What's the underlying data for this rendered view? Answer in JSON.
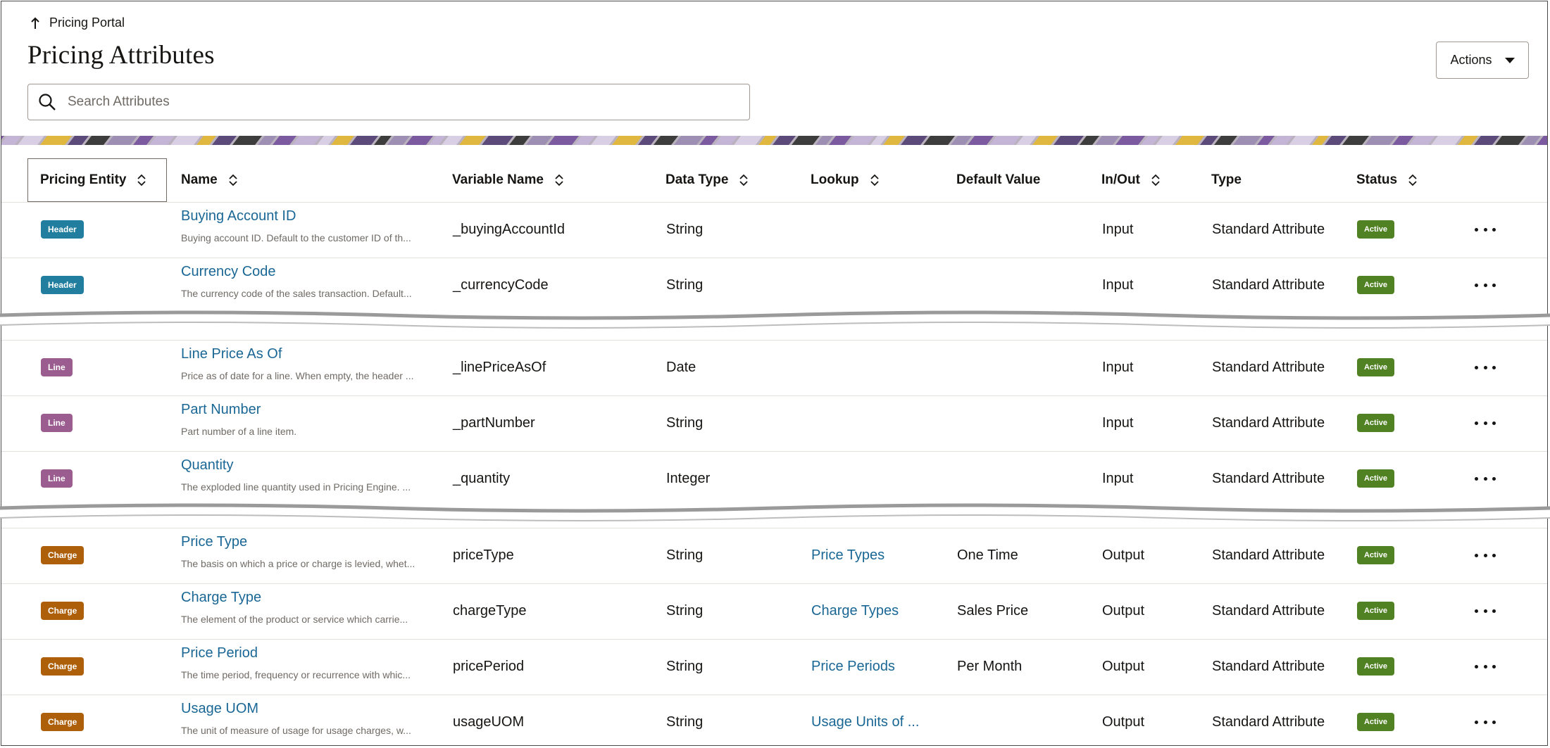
{
  "breadcrumb": {
    "label": "Pricing Portal"
  },
  "page": {
    "title": "Pricing Attributes"
  },
  "search": {
    "placeholder": "Search Attributes",
    "value": ""
  },
  "actions": {
    "label": "Actions"
  },
  "columns": [
    "Pricing Entity",
    "Name",
    "Variable Name",
    "Data Type",
    "Lookup",
    "Default Value",
    "In/Out",
    "Type",
    "Status"
  ],
  "rows": [
    {
      "entity": "Header",
      "entity_color": "#227e9e",
      "name": "Buying Account ID",
      "description": "Buying account ID. Default to the customer ID of th...",
      "variable": "_buyingAccountId",
      "data_type": "String",
      "lookup": "",
      "default_value": "",
      "in_out": "Input",
      "type": "Standard Attribute",
      "status": "Active"
    },
    {
      "entity": "Header",
      "entity_color": "#227e9e",
      "name": "Currency Code",
      "description": "The currency code of the sales transaction. Default...",
      "variable": "_currencyCode",
      "data_type": "String",
      "lookup": "",
      "default_value": "",
      "in_out": "Input",
      "type": "Standard Attribute",
      "status": "Active"
    },
    {
      "entity": "Line",
      "entity_color": "#9b5c8f",
      "name": "Line Price As Of",
      "description": "Price as of date for a line. When empty, the header ...",
      "variable": "_linePriceAsOf",
      "data_type": "Date",
      "lookup": "",
      "default_value": "",
      "in_out": "Input",
      "type": "Standard Attribute",
      "status": "Active"
    },
    {
      "entity": "Line",
      "entity_color": "#9b5c8f",
      "name": "Part Number",
      "description": "Part number of a line item.",
      "variable": "_partNumber",
      "data_type": "String",
      "lookup": "",
      "default_value": "",
      "in_out": "Input",
      "type": "Standard Attribute",
      "status": "Active"
    },
    {
      "entity": "Line",
      "entity_color": "#9b5c8f",
      "name": "Quantity",
      "description": "The exploded line quantity used in Pricing Engine. ...",
      "variable": "_quantity",
      "data_type": "Integer",
      "lookup": "",
      "default_value": "",
      "in_out": "Input",
      "type": "Standard Attribute",
      "status": "Active"
    },
    {
      "entity": "Charge",
      "entity_color": "#ad5f0a",
      "name": "Price Type",
      "description": "The basis on which a price or charge is levied, whet...",
      "variable": "priceType",
      "data_type": "String",
      "lookup": "Price Types",
      "default_value": "One Time",
      "in_out": "Output",
      "type": "Standard Attribute",
      "status": "Active"
    },
    {
      "entity": "Charge",
      "entity_color": "#ad5f0a",
      "name": "Charge Type",
      "description": "The element of the product or service which carrie...",
      "variable": "chargeType",
      "data_type": "String",
      "lookup": "Charge Types",
      "default_value": "Sales Price",
      "in_out": "Output",
      "type": "Standard Attribute",
      "status": "Active"
    },
    {
      "entity": "Charge",
      "entity_color": "#ad5f0a",
      "name": "Price Period",
      "description": "The time period, frequency or recurrence with whic...",
      "variable": "pricePeriod",
      "data_type": "String",
      "lookup": "Price Periods",
      "default_value": "Per Month",
      "in_out": "Output",
      "type": "Standard Attribute",
      "status": "Active"
    },
    {
      "entity": "Charge",
      "entity_color": "#ad5f0a",
      "name": "Usage UOM",
      "description": "The unit of measure of usage for usage charges, w...",
      "variable": "usageUOM",
      "data_type": "String",
      "lookup": "Usage Units of ...",
      "default_value": "",
      "in_out": "Output",
      "type": "Standard Attribute",
      "status": "Active"
    }
  ],
  "colors": {
    "link": "#1a6795",
    "active_status": "#508223"
  },
  "icons": {
    "back": "arrow-up-icon",
    "search": "search-icon",
    "sort": "sort-icon",
    "more": "more-horizontal-icon"
  }
}
